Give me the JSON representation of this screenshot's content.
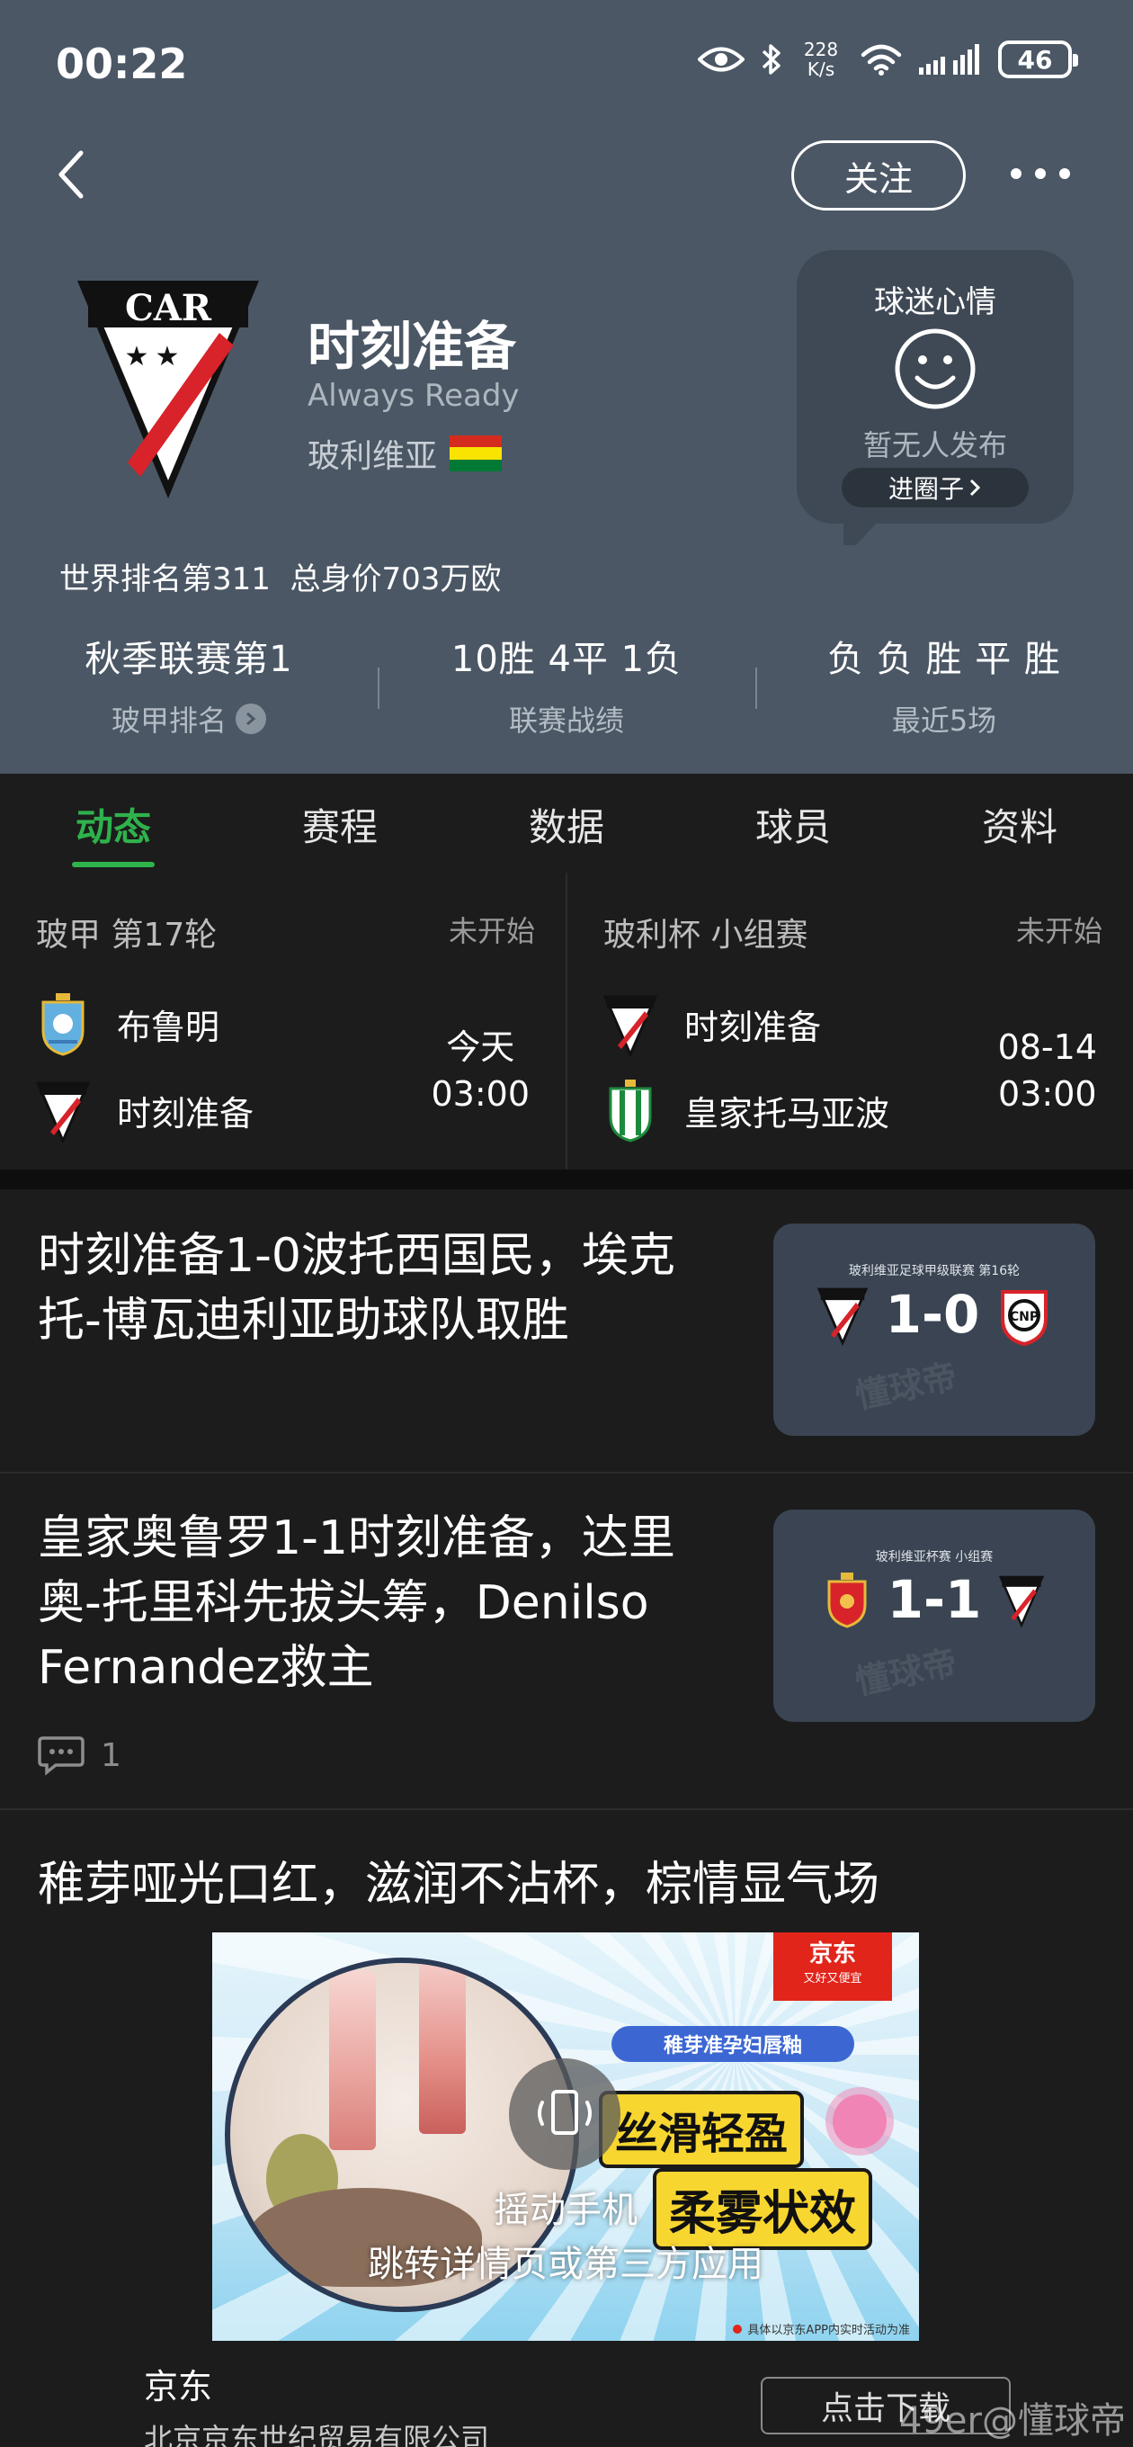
{
  "status_bar": {
    "time": "00:22",
    "net_speed_value": "228",
    "net_speed_unit": "K/s",
    "battery": "46"
  },
  "header": {
    "follow_label": "关注",
    "team_name": "时刻准备",
    "team_name_en": "Always Ready",
    "country": "玻利维亚",
    "crest_text": "CAR",
    "world_rank": "世界排名第311",
    "market_value": "总身价703万欧",
    "colors": {
      "background": "#4b5765",
      "accent_green": "#2fb24c",
      "crest_red": "#d8232a"
    }
  },
  "fan_mood": {
    "title": "球迷心情",
    "empty_text": "暂无人发布",
    "join_label": "进圈子"
  },
  "stats": [
    {
      "value": "秋季联赛第1",
      "label": "玻甲排名"
    },
    {
      "value": "10胜 4平 1负",
      "label": "联赛战绩"
    },
    {
      "value": "负 负 胜 平 胜",
      "label": "最近5场"
    }
  ],
  "tabs": [
    {
      "label": "动态",
      "active": true
    },
    {
      "label": "赛程",
      "active": false
    },
    {
      "label": "数据",
      "active": false
    },
    {
      "label": "球员",
      "active": false
    },
    {
      "label": "资料",
      "active": false
    }
  ],
  "matches": [
    {
      "competition": "玻甲 第17轮",
      "status": "未开始",
      "home": "布鲁明",
      "away": "时刻准备",
      "date": "今天",
      "time": "03:00"
    },
    {
      "competition": "玻利杯 小组赛",
      "status": "未开始",
      "home": "时刻准备",
      "away": "皇家托马亚波",
      "date": "08-14",
      "time": "03:00"
    }
  ],
  "news": [
    {
      "title": "时刻准备1-0波托西国民，埃克托-博瓦迪利亚助球队取胜",
      "thumb_caption": "玻利维亚足球甲级联赛 第16轮",
      "score": "1-0",
      "thumb_watermark": "懂球帝"
    },
    {
      "title": "皇家奥鲁罗1-1时刻准备，达里奥-托里科先拔头筹，Denilso Fernandez救主",
      "thumb_caption": "玻利维亚杯赛 小组赛",
      "score": "1-1",
      "thumb_watermark": "懂球帝",
      "comments": "1"
    }
  ],
  "ad": {
    "title": "稚芽哑光口红，滋润不沾杯，棕情显气场",
    "brand_badge": "京东",
    "brand_slogan": "又好又便宜",
    "pill_text": "稚芽准孕妇唇釉",
    "headline1": "丝滑轻盈",
    "headline2": "柔雾状效",
    "shake_line1": "摇动手机",
    "shake_line2": "跳转详情页或第三方应用",
    "note": "具体以京东APP内实时活动为准",
    "advertiser": "京东",
    "company": "北京京东世纪贸易有限公司",
    "download_label": "点击下载"
  },
  "watermark": "49er@懂球帝"
}
